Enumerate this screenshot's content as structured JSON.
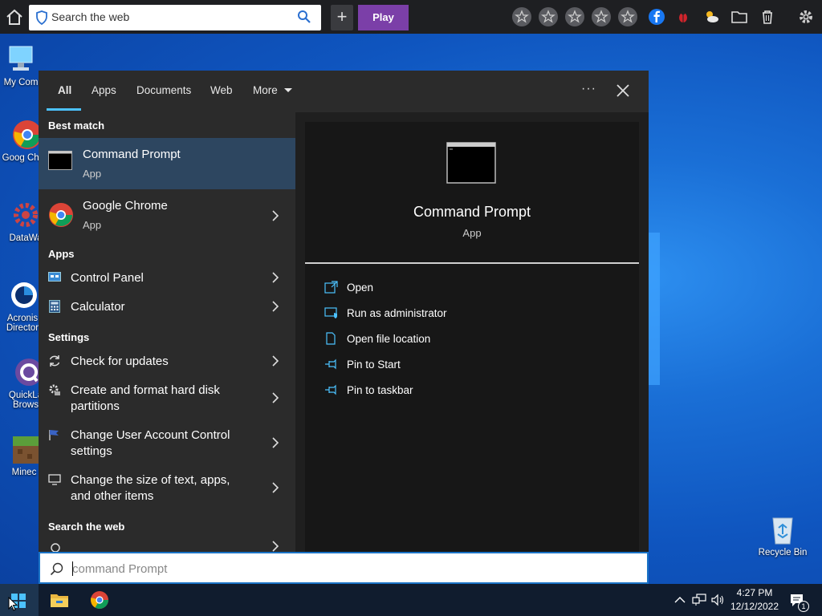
{
  "browser_bar": {
    "search_placeholder": "Search the web",
    "play_label": "Play"
  },
  "desktop": {
    "icons": [
      {
        "label": "My Com"
      },
      {
        "label": "Goog Chron"
      },
      {
        "label": "DataWa"
      },
      {
        "label": "Acronis Director"
      },
      {
        "label": "QuickLa Brows"
      },
      {
        "label": "Minec"
      },
      {
        "label": "Recycle Bin"
      }
    ]
  },
  "menu": {
    "tabs": [
      "All",
      "Apps",
      "Documents",
      "Web",
      "More"
    ],
    "active_tab": "All",
    "sections": {
      "best_match": "Best match",
      "apps": "Apps",
      "settings": "Settings",
      "search_web": "Search the web"
    },
    "best_match": {
      "title": "Command Prompt",
      "subtitle": "App"
    },
    "chrome": {
      "title": "Google Chrome",
      "subtitle": "App"
    },
    "apps": [
      {
        "label": "Control Panel"
      },
      {
        "label": "Calculator"
      }
    ],
    "settings": [
      {
        "line1": "Check for updates",
        "line2": ""
      },
      {
        "line1": "Create and format hard disk",
        "line2": "partitions"
      },
      {
        "line1": "Change User Account Control",
        "line2": "settings"
      },
      {
        "line1": "Change the size of text, apps,",
        "line2": "and other items"
      }
    ],
    "preview": {
      "title": "Command Prompt",
      "subtitle": "App",
      "actions": [
        "Open",
        "Run as administrator",
        "Open file location",
        "Pin to Start",
        "Pin to taskbar"
      ]
    }
  },
  "search_query": {
    "value": "command Prompt"
  },
  "taskbar": {
    "time": "4:27 PM",
    "date": "12/12/2022",
    "notification_count": "1"
  },
  "colors": {
    "accent": "#4cc2ff",
    "play": "#7b3fa8",
    "selected_row": "#2d4660"
  }
}
